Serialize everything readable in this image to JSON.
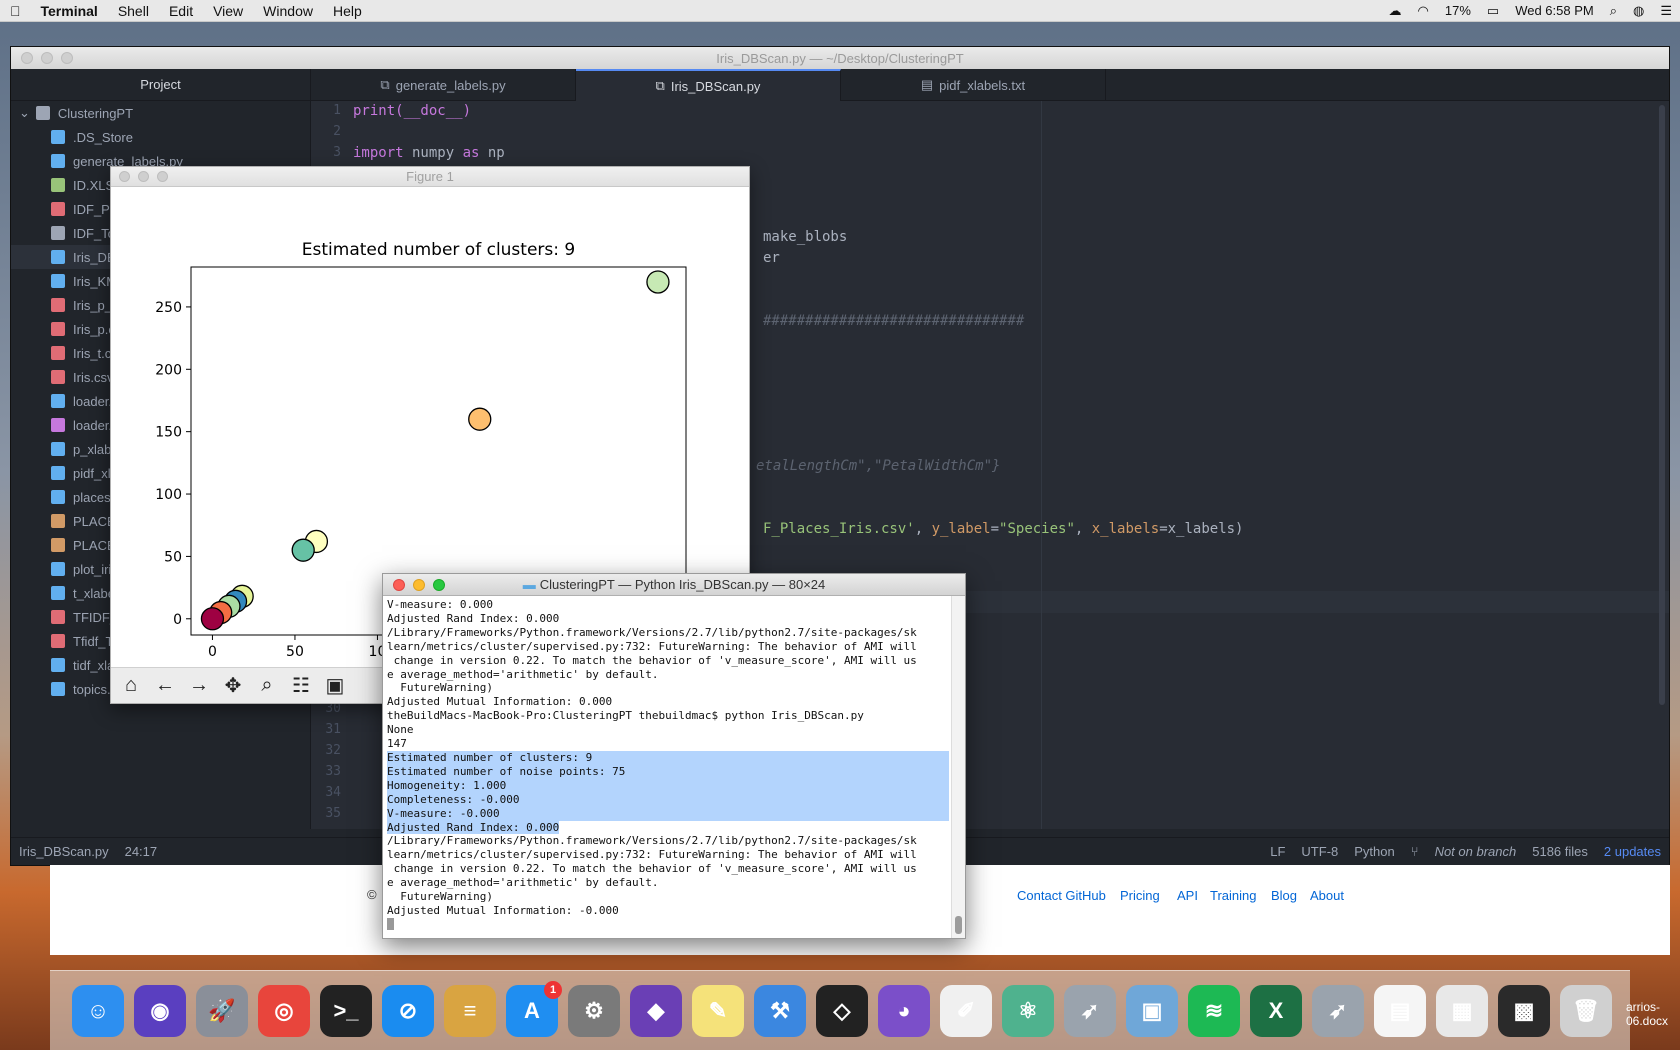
{
  "menubar": {
    "app_name": "Terminal",
    "items": [
      "Shell",
      "Edit",
      "View",
      "Window",
      "Help"
    ],
    "battery": "17%",
    "clock": "Wed 6:58 PM"
  },
  "atom": {
    "window_title": "Iris_DBScan.py — ~/Desktop/ClusteringPT",
    "tabs": [
      "generate_labels.py",
      "Iris_DBScan.py",
      "pidf_xlabels.txt"
    ],
    "project_label": "Project",
    "root_folder": "ClusteringPT",
    "files": [
      ".DS_Store",
      "generate_labels.py",
      "ID.XLS",
      "IDF_Pla",
      "IDF_To",
      "Iris_DB",
      "Iris_KM",
      "Iris_p_t",
      "Iris_p.c",
      "Iris_t.c",
      "Iris.csv",
      "loader.",
      "loader.",
      "p_xlabe",
      "pidf_xl",
      "places",
      "PLACE",
      "PLACE",
      "plot_iri",
      "t_xlabe",
      "TFIDF_",
      "Tfidf_T",
      "tidf_xla",
      "topics."
    ],
    "code_lines": {
      "l1": "print(__doc__)",
      "l3_kw": "import",
      "l3_a": " numpy ",
      "l3_kw2": "as",
      "l3_b": " np",
      "l7": "make_blobs",
      "l8": "er",
      "l11": "###############################",
      "l18": "etalLengthCm\",\"PetalWidthCm\"}",
      "l21_a": "F_Places_Iris.csv'",
      "l21_b": ", ",
      "l21_c": "y_label",
      "l21_d": "=",
      "l21_e": "\"Species\"",
      "l21_f": ", ",
      "l21_g": "x_labels",
      "l21_h": "=x_labels)"
    },
    "line_numbers_top": [
      "1",
      "2",
      "3"
    ],
    "line_numbers_bottom": [
      "30",
      "31",
      "32",
      "33",
      "34",
      "35"
    ],
    "status": {
      "file": "Iris_DBScan.py",
      "cursor": "24:17",
      "line_ending": "LF",
      "encoding": "UTF-8",
      "grammar": "Python",
      "branch": "Not on branch",
      "files_count": "5186 files",
      "updates": "2 updates"
    }
  },
  "github_footer": {
    "links": [
      "Contact GitHub",
      "Pricing",
      "API",
      "Training",
      "Blog",
      "About"
    ],
    "copyright_glyph": "©"
  },
  "figure": {
    "window_title": "Figure 1",
    "toolbar_icons": [
      "home-icon",
      "back-arrow-icon",
      "forward-arrow-icon",
      "pan-icon",
      "zoom-icon",
      "configure-icon",
      "save-icon"
    ]
  },
  "chart_data": {
    "type": "scatter",
    "title": "Estimated number of clusters: 9",
    "xlabel": "",
    "ylabel": "",
    "xlim": [
      -13,
      287
    ],
    "ylim": [
      -13,
      282
    ],
    "x_ticks": [
      "0",
      "50",
      "10"
    ],
    "y_ticks": [
      "0",
      "50",
      "100",
      "150",
      "200",
      "250"
    ],
    "points": [
      {
        "x": 270,
        "y": 270,
        "color": "#c7e9b4"
      },
      {
        "x": 162,
        "y": 160,
        "color": "#fdbf6f"
      },
      {
        "x": 63,
        "y": 62,
        "color": "#ffffbf"
      },
      {
        "x": 55,
        "y": 55,
        "color": "#66c2a5"
      },
      {
        "x": 18,
        "y": 18,
        "color": "#e6f598"
      },
      {
        "x": 14,
        "y": 14,
        "color": "#3288bd"
      },
      {
        "x": 10,
        "y": 10,
        "color": "#abdda4"
      },
      {
        "x": 5,
        "y": 5,
        "color": "#f46d43"
      },
      {
        "x": 0,
        "y": 0,
        "color": "#9e0142"
      }
    ]
  },
  "terminal": {
    "window_title": "ClusteringPT — Python Iris_DBScan.py — 80×24",
    "lines_before": [
      "V-measure: 0.000",
      "Adjusted Rand Index: 0.000",
      "/Library/Frameworks/Python.framework/Versions/2.7/lib/python2.7/site-packages/sk",
      "learn/metrics/cluster/supervised.py:732: FutureWarning: The behavior of AMI will",
      " change in version 0.22. To match the behavior of 'v_measure_score', AMI will us",
      "e average_method='arithmetic' by default.",
      "  FutureWarning)",
      "Adjusted Mutual Information: 0.000",
      "theBuildMacs-MacBook-Pro:ClusteringPT thebuildmac$ python Iris_DBScan.py",
      "None",
      "147"
    ],
    "lines_selected": [
      "Estimated number of clusters: 9",
      "Estimated number of noise points: 75",
      "Homogeneity: 1.000",
      "Completeness: -0.000",
      "V-measure: -0.000"
    ],
    "line_partial_selected": "Adjusted Rand Index: 0.000",
    "lines_after": [
      "/Library/Frameworks/Python.framework/Versions/2.7/lib/python2.7/site-packages/sk",
      "learn/metrics/cluster/supervised.py:732: FutureWarning: The behavior of AMI will",
      " change in version 0.22. To match the behavior of 'v_measure_score', AMI will us",
      "e average_method='arithmetic' by default.",
      "  FutureWarning)",
      "Adjusted Mutual Information: -0.000"
    ]
  },
  "dock": {
    "apps": [
      {
        "name": "finder-icon",
        "color": "#2d8ff0",
        "glyph": "☺"
      },
      {
        "name": "siri-icon",
        "color": "#5a3fc0",
        "glyph": "◉"
      },
      {
        "name": "launchpad-icon",
        "color": "#8a8f99",
        "glyph": "🚀"
      },
      {
        "name": "chrome-icon",
        "color": "#e8453c",
        "glyph": "◎"
      },
      {
        "name": "terminal-icon",
        "color": "#222222",
        "glyph": ">_"
      },
      {
        "name": "safari-icon",
        "color": "#1a8cf0",
        "glyph": "⊘"
      },
      {
        "name": "sequel-pro-icon",
        "color": "#d9a441",
        "glyph": "≡"
      },
      {
        "name": "app-store-icon",
        "color": "#1f8ef1",
        "glyph": "A",
        "badge": "1"
      },
      {
        "name": "system-preferences-icon",
        "color": "#7a7a7a",
        "glyph": "⚙"
      },
      {
        "name": "visual-studio-icon",
        "color": "#6a3fb5",
        "glyph": "◆"
      },
      {
        "name": "notes-icon",
        "color": "#f5e27a",
        "glyph": "✎"
      },
      {
        "name": "xcode-icon",
        "color": "#3b87e0",
        "glyph": "⚒"
      },
      {
        "name": "unity-icon",
        "color": "#222222",
        "glyph": "◇"
      },
      {
        "name": "github-desktop-icon",
        "color": "#7b4fc9",
        "glyph": "◕"
      },
      {
        "name": "textedit-icon",
        "color": "#f0f0f0",
        "glyph": "✐"
      },
      {
        "name": "atom-icon",
        "color": "#4fb28e",
        "glyph": "⚛"
      },
      {
        "name": "rocket-icon",
        "color": "#9aa3ad",
        "glyph": "➶"
      },
      {
        "name": "preview-icon",
        "color": "#6fa7d8",
        "glyph": "▣"
      },
      {
        "name": "spotify-icon",
        "color": "#1db954",
        "glyph": "≋"
      },
      {
        "name": "excel-icon",
        "color": "#1d7044",
        "glyph": "X"
      },
      {
        "name": "rocket-icon-2",
        "color": "#9aa3ad",
        "glyph": "➶"
      },
      {
        "name": "txt-document-icon",
        "color": "#f5f5f5",
        "glyph": "▤"
      },
      {
        "name": "spreadsheet-document-icon",
        "color": "#e8e8e8",
        "glyph": "▦"
      },
      {
        "name": "screenshot-document-icon",
        "color": "#2a2a2a",
        "glyph": "▩"
      },
      {
        "name": "trash-icon",
        "color": "#d0d0d0",
        "glyph": "🗑"
      }
    ]
  },
  "desktop": {
    "docx_label": "arrios-06.docx"
  }
}
